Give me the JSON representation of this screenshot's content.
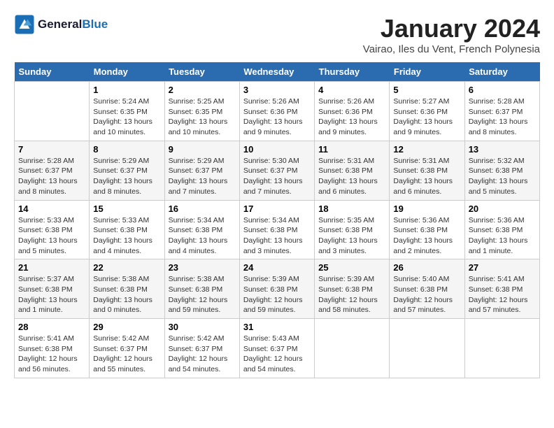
{
  "header": {
    "logo_line1": "General",
    "logo_line2": "Blue",
    "month_title": "January 2024",
    "location": "Vairao, Iles du Vent, French Polynesia"
  },
  "days_of_week": [
    "Sunday",
    "Monday",
    "Tuesday",
    "Wednesday",
    "Thursday",
    "Friday",
    "Saturday"
  ],
  "weeks": [
    [
      {
        "num": "",
        "detail": ""
      },
      {
        "num": "1",
        "detail": "Sunrise: 5:24 AM\nSunset: 6:35 PM\nDaylight: 13 hours\nand 10 minutes."
      },
      {
        "num": "2",
        "detail": "Sunrise: 5:25 AM\nSunset: 6:35 PM\nDaylight: 13 hours\nand 10 minutes."
      },
      {
        "num": "3",
        "detail": "Sunrise: 5:26 AM\nSunset: 6:36 PM\nDaylight: 13 hours\nand 9 minutes."
      },
      {
        "num": "4",
        "detail": "Sunrise: 5:26 AM\nSunset: 6:36 PM\nDaylight: 13 hours\nand 9 minutes."
      },
      {
        "num": "5",
        "detail": "Sunrise: 5:27 AM\nSunset: 6:36 PM\nDaylight: 13 hours\nand 9 minutes."
      },
      {
        "num": "6",
        "detail": "Sunrise: 5:28 AM\nSunset: 6:37 PM\nDaylight: 13 hours\nand 8 minutes."
      }
    ],
    [
      {
        "num": "7",
        "detail": "Sunrise: 5:28 AM\nSunset: 6:37 PM\nDaylight: 13 hours\nand 8 minutes."
      },
      {
        "num": "8",
        "detail": "Sunrise: 5:29 AM\nSunset: 6:37 PM\nDaylight: 13 hours\nand 8 minutes."
      },
      {
        "num": "9",
        "detail": "Sunrise: 5:29 AM\nSunset: 6:37 PM\nDaylight: 13 hours\nand 7 minutes."
      },
      {
        "num": "10",
        "detail": "Sunrise: 5:30 AM\nSunset: 6:37 PM\nDaylight: 13 hours\nand 7 minutes."
      },
      {
        "num": "11",
        "detail": "Sunrise: 5:31 AM\nSunset: 6:38 PM\nDaylight: 13 hours\nand 6 minutes."
      },
      {
        "num": "12",
        "detail": "Sunrise: 5:31 AM\nSunset: 6:38 PM\nDaylight: 13 hours\nand 6 minutes."
      },
      {
        "num": "13",
        "detail": "Sunrise: 5:32 AM\nSunset: 6:38 PM\nDaylight: 13 hours\nand 5 minutes."
      }
    ],
    [
      {
        "num": "14",
        "detail": "Sunrise: 5:33 AM\nSunset: 6:38 PM\nDaylight: 13 hours\nand 5 minutes."
      },
      {
        "num": "15",
        "detail": "Sunrise: 5:33 AM\nSunset: 6:38 PM\nDaylight: 13 hours\nand 4 minutes."
      },
      {
        "num": "16",
        "detail": "Sunrise: 5:34 AM\nSunset: 6:38 PM\nDaylight: 13 hours\nand 4 minutes."
      },
      {
        "num": "17",
        "detail": "Sunrise: 5:34 AM\nSunset: 6:38 PM\nDaylight: 13 hours\nand 3 minutes."
      },
      {
        "num": "18",
        "detail": "Sunrise: 5:35 AM\nSunset: 6:38 PM\nDaylight: 13 hours\nand 3 minutes."
      },
      {
        "num": "19",
        "detail": "Sunrise: 5:36 AM\nSunset: 6:38 PM\nDaylight: 13 hours\nand 2 minutes."
      },
      {
        "num": "20",
        "detail": "Sunrise: 5:36 AM\nSunset: 6:38 PM\nDaylight: 13 hours\nand 1 minute."
      }
    ],
    [
      {
        "num": "21",
        "detail": "Sunrise: 5:37 AM\nSunset: 6:38 PM\nDaylight: 13 hours\nand 1 minute."
      },
      {
        "num": "22",
        "detail": "Sunrise: 5:38 AM\nSunset: 6:38 PM\nDaylight: 13 hours\nand 0 minutes."
      },
      {
        "num": "23",
        "detail": "Sunrise: 5:38 AM\nSunset: 6:38 PM\nDaylight: 12 hours\nand 59 minutes."
      },
      {
        "num": "24",
        "detail": "Sunrise: 5:39 AM\nSunset: 6:38 PM\nDaylight: 12 hours\nand 59 minutes."
      },
      {
        "num": "25",
        "detail": "Sunrise: 5:39 AM\nSunset: 6:38 PM\nDaylight: 12 hours\nand 58 minutes."
      },
      {
        "num": "26",
        "detail": "Sunrise: 5:40 AM\nSunset: 6:38 PM\nDaylight: 12 hours\nand 57 minutes."
      },
      {
        "num": "27",
        "detail": "Sunrise: 5:41 AM\nSunset: 6:38 PM\nDaylight: 12 hours\nand 57 minutes."
      }
    ],
    [
      {
        "num": "28",
        "detail": "Sunrise: 5:41 AM\nSunset: 6:38 PM\nDaylight: 12 hours\nand 56 minutes."
      },
      {
        "num": "29",
        "detail": "Sunrise: 5:42 AM\nSunset: 6:37 PM\nDaylight: 12 hours\nand 55 minutes."
      },
      {
        "num": "30",
        "detail": "Sunrise: 5:42 AM\nSunset: 6:37 PM\nDaylight: 12 hours\nand 54 minutes."
      },
      {
        "num": "31",
        "detail": "Sunrise: 5:43 AM\nSunset: 6:37 PM\nDaylight: 12 hours\nand 54 minutes."
      },
      {
        "num": "",
        "detail": ""
      },
      {
        "num": "",
        "detail": ""
      },
      {
        "num": "",
        "detail": ""
      }
    ]
  ]
}
